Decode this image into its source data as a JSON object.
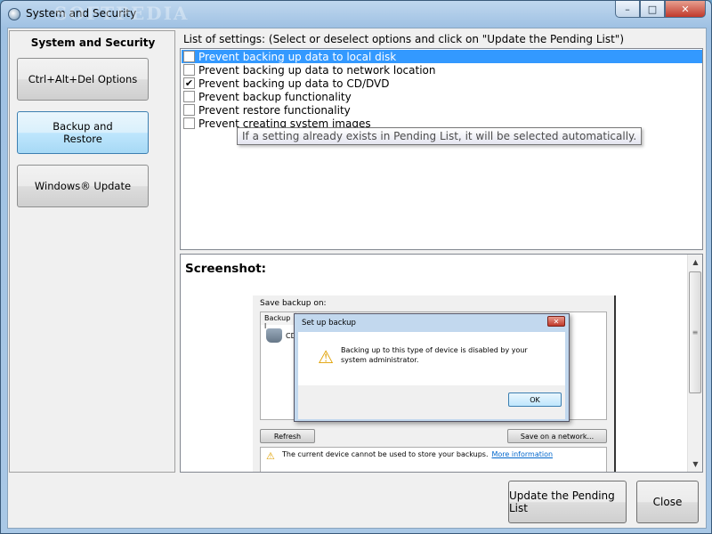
{
  "window": {
    "title": "System and Security",
    "watermark": "SOFTPEDIA",
    "controls": {
      "minimize": "–",
      "maximize": "□",
      "close": "✕"
    }
  },
  "sidebar": {
    "title": "System and Security",
    "items": [
      {
        "label": "Ctrl+Alt+Del Options",
        "active": false
      },
      {
        "label": "Backup and\nRestore",
        "active": true
      },
      {
        "label": "Windows® Update",
        "active": false
      }
    ]
  },
  "settings": {
    "label": "List of settings: (Select or deselect options and click on \"Update the Pending List\")",
    "items": [
      {
        "label": "Prevent backing up data to local disk",
        "checked": false,
        "selected": true
      },
      {
        "label": "Prevent backing up data to network location",
        "checked": false,
        "selected": false
      },
      {
        "label": "Prevent backing up data to CD/DVD",
        "checked": true,
        "selected": false
      },
      {
        "label": "Prevent backup functionality",
        "checked": false,
        "selected": false
      },
      {
        "label": "Prevent restore functionality",
        "checked": false,
        "selected": false
      },
      {
        "label": "Prevent creating system images",
        "checked": false,
        "selected": false
      }
    ],
    "tooltip": "If a setting already exists in Pending List, it will be selected automatically."
  },
  "screenshot": {
    "title": "Screenshot:",
    "embed": {
      "save_label": "Save backup on:",
      "list_header": "Backup l",
      "drive_text": "CD",
      "dialog_title": "Set up backup",
      "dialog_close": "✕",
      "dialog_message": "Backing up to this type of device is disabled by your system administrator.",
      "ok_label": "OK",
      "refresh_label": "Refresh",
      "save_network_label": "Save on a network...",
      "note_text": "The current device cannot be used to store your backups.",
      "note_link": "More information",
      "warn_glyph": "⚠"
    },
    "scroll": {
      "up": "▲",
      "down": "▼",
      "grip": "≡"
    }
  },
  "footer": {
    "update_label": "Update the Pending List",
    "close_label": "Close"
  }
}
